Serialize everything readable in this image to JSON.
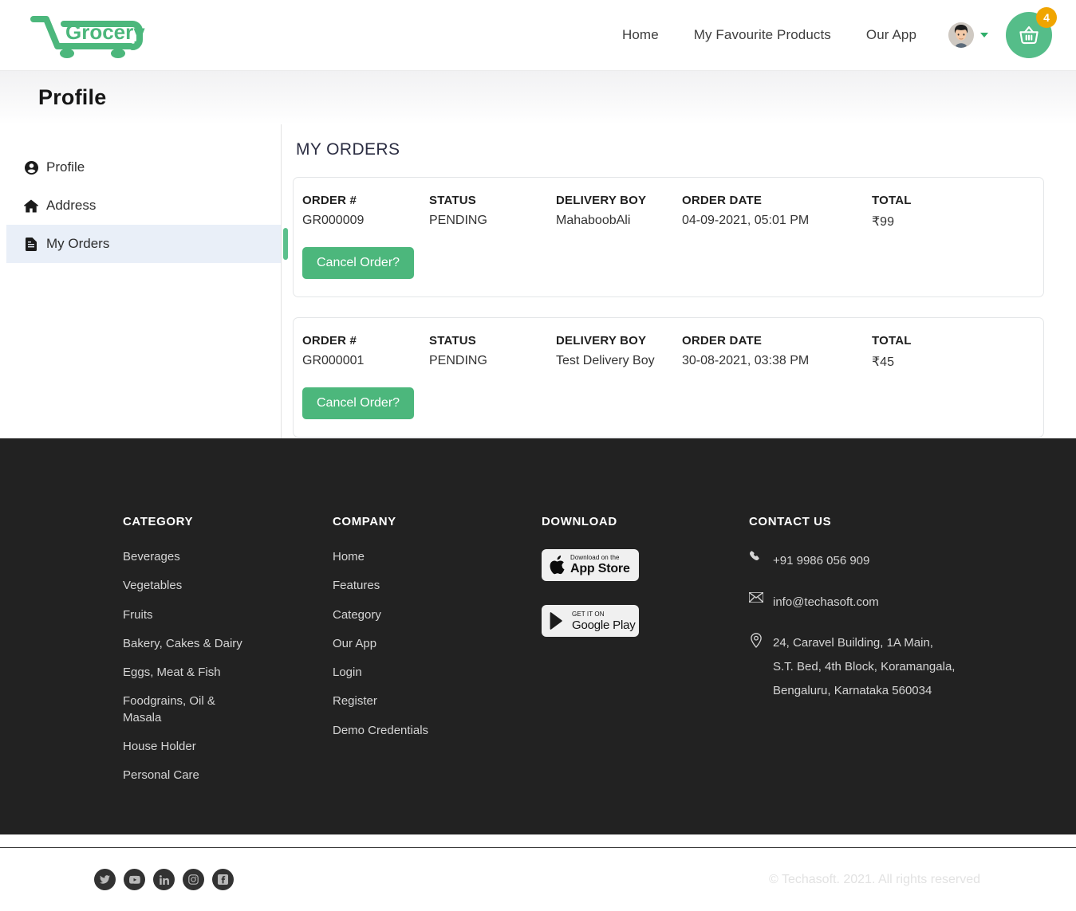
{
  "navbar": {
    "logo_text": "Grocery",
    "links": [
      {
        "label": "Home"
      },
      {
        "label": "My Favourite Products"
      },
      {
        "label": "Our App"
      }
    ],
    "cart_badge": "4",
    "accent_green": "#4cb77c",
    "badge_color": "#f0a500"
  },
  "page": {
    "title": "Profile"
  },
  "sidebar": {
    "items": [
      {
        "label": "Profile",
        "icon": "user-circle-icon",
        "active": false
      },
      {
        "label": "Address",
        "icon": "home-icon",
        "active": false
      },
      {
        "label": "My Orders",
        "icon": "file-text-icon",
        "active": true
      }
    ]
  },
  "orders_section": {
    "title": "MY ORDERS",
    "columns": [
      "ORDER #",
      "STATUS",
      "DELIVERY BOY",
      "ORDER DATE",
      "TOTAL"
    ],
    "cancel_label": "Cancel Order?",
    "orders": [
      {
        "order_no": "GR000009",
        "status": "PENDING",
        "delivery_boy": "MahaboobAli",
        "order_date": "04-09-2021, 05:01 PM",
        "total": "₹99"
      },
      {
        "order_no": "GR000001",
        "status": "PENDING",
        "delivery_boy": "Test Delivery Boy",
        "order_date": "30-08-2021, 03:38 PM",
        "total": "₹45"
      }
    ]
  },
  "footer": {
    "category": {
      "heading": "CATEGORY",
      "links": [
        "Beverages",
        "Vegetables",
        "Fruits",
        "Bakery, Cakes & Dairy",
        "Eggs, Meat & Fish",
        "Foodgrains, Oil & Masala",
        "House Holder",
        "Personal Care"
      ]
    },
    "company": {
      "heading": "COMPANY",
      "links": [
        "Home",
        "Features",
        "Category",
        "Our App",
        "Login",
        "Register",
        "Demo Credentials"
      ]
    },
    "download": {
      "heading": "DOWNLOAD",
      "appstore_small": "Download on the",
      "appstore_big": "App Store",
      "play_small": "GET IT ON",
      "play_big": "Google Play"
    },
    "contact": {
      "heading": "CONTACT US",
      "phone": "+91 9986 056 909",
      "email": "info@techasoft.com",
      "address_line1": "24, Caravel Building, 1A Main,",
      "address_line2": "S.T. Bed, 4th Block, Koramangala,",
      "address_line3": "Bengaluru, Karnataka 560034"
    },
    "socials": [
      "twitter-icon",
      "youtube-icon",
      "linkedin-icon",
      "instagram-icon",
      "facebook-icon"
    ],
    "copyright": "© Techasoft. 2021. All rights reserved",
    "background": "#222222"
  }
}
